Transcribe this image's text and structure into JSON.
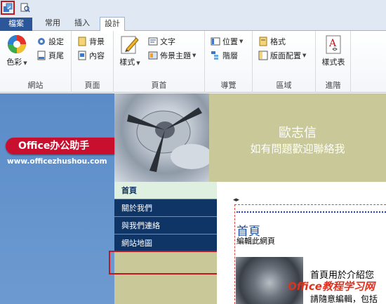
{
  "ribbon_tabs": {
    "file": "檔案",
    "home": "常用",
    "insert": "插入",
    "design": "設計"
  },
  "groups": {
    "website": {
      "label": "網站",
      "color": "色彩",
      "settings": "設定",
      "footer": "頁尾"
    },
    "page": {
      "label": "頁面",
      "background": "背景",
      "content": "內容"
    },
    "header": {
      "label": "頁首",
      "style": "樣式",
      "text": "文字",
      "theme": "佈景主題"
    },
    "navigation": {
      "label": "導覽",
      "position": "位置",
      "levels": "階層"
    },
    "region": {
      "label": "區域",
      "format": "格式",
      "layout": "版面配置"
    },
    "advanced": {
      "label": "進階",
      "stylesheet": "樣式表"
    }
  },
  "site": {
    "title": "歐志信",
    "subtitle": "如有問題歡迎聯絡我",
    "logo_text": "Office办公助手",
    "logo_url": "www.officezhushou.com",
    "nav": [
      "首頁",
      "關於我們",
      "與我們連絡",
      "網站地圖"
    ],
    "content_tag": "◂▸",
    "page_heading": "首頁",
    "edit_link": "編輯此網頁",
    "body_text": "首頁用於介紹您",
    "body_text2": "請隨意編輯，包括"
  },
  "watermark": "Office教程学习网"
}
